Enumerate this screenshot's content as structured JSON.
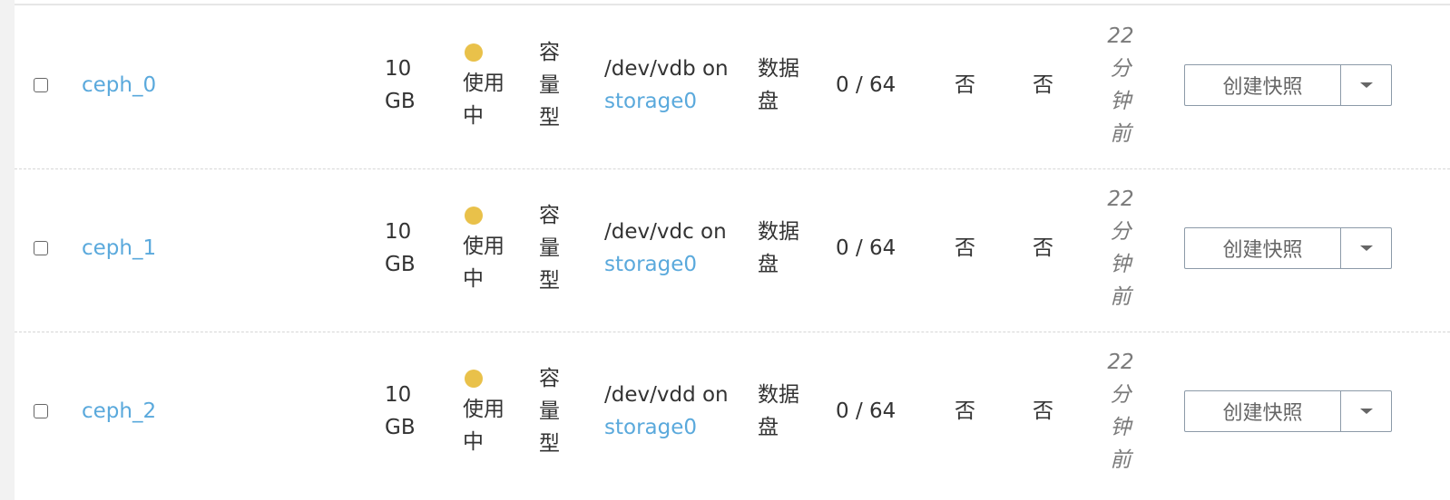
{
  "rows": [
    {
      "name": "ceph_0",
      "size": "10 GB",
      "status": "使用中",
      "status_color": "#e9c14a",
      "volume_type": "容量型",
      "attach_device": "/dev/vdb",
      "attach_on": "on",
      "attach_server": "storage0",
      "disk_kind": "数据盘",
      "snapshots": "0 / 64",
      "flag_a": "否",
      "flag_b": "否",
      "created": "22分钟前",
      "action_label": "创建快照"
    },
    {
      "name": "ceph_1",
      "size": "10 GB",
      "status": "使用中",
      "status_color": "#e9c14a",
      "volume_type": "容量型",
      "attach_device": "/dev/vdc",
      "attach_on": "on",
      "attach_server": "storage0",
      "disk_kind": "数据盘",
      "snapshots": "0 / 64",
      "flag_a": "否",
      "flag_b": "否",
      "created": "22分钟前",
      "action_label": "创建快照"
    },
    {
      "name": "ceph_2",
      "size": "10 GB",
      "status": "使用中",
      "status_color": "#e9c14a",
      "volume_type": "容量型",
      "attach_device": "/dev/vdd",
      "attach_on": "on",
      "attach_server": "storage0",
      "disk_kind": "数据盘",
      "snapshots": "0 / 64",
      "flag_a": "否",
      "flag_b": "否",
      "created": "22分钟前",
      "action_label": "创建快照"
    }
  ],
  "colors": {
    "link": "#5aa9dc",
    "text": "#333333",
    "muted": "#7a7a7a",
    "button_border": "#8c9aa8"
  },
  "icons": {
    "row_checkbox": "checkbox-icon",
    "status": "status-dot-icon",
    "dropdown": "chevron-down-icon"
  }
}
